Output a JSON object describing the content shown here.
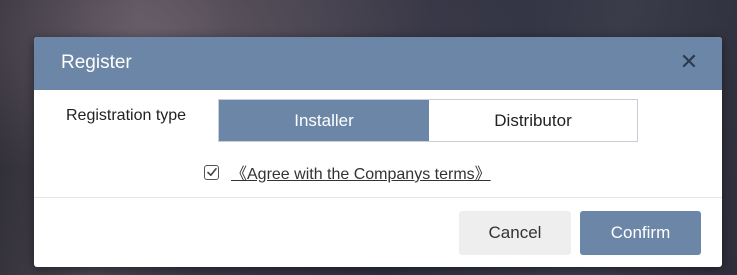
{
  "dialog": {
    "title": "Register",
    "close_icon": "close-icon"
  },
  "registration": {
    "label": "Registration type",
    "options": [
      "Installer",
      "Distributor"
    ],
    "selected": "Installer"
  },
  "agreement": {
    "checked": true,
    "link_text": "《Agree with the Companys terms》"
  },
  "buttons": {
    "cancel_label": "Cancel",
    "confirm_label": "Confirm"
  },
  "colors": {
    "accent": "#6b86a6",
    "cancel_bg": "#eeeeee"
  }
}
